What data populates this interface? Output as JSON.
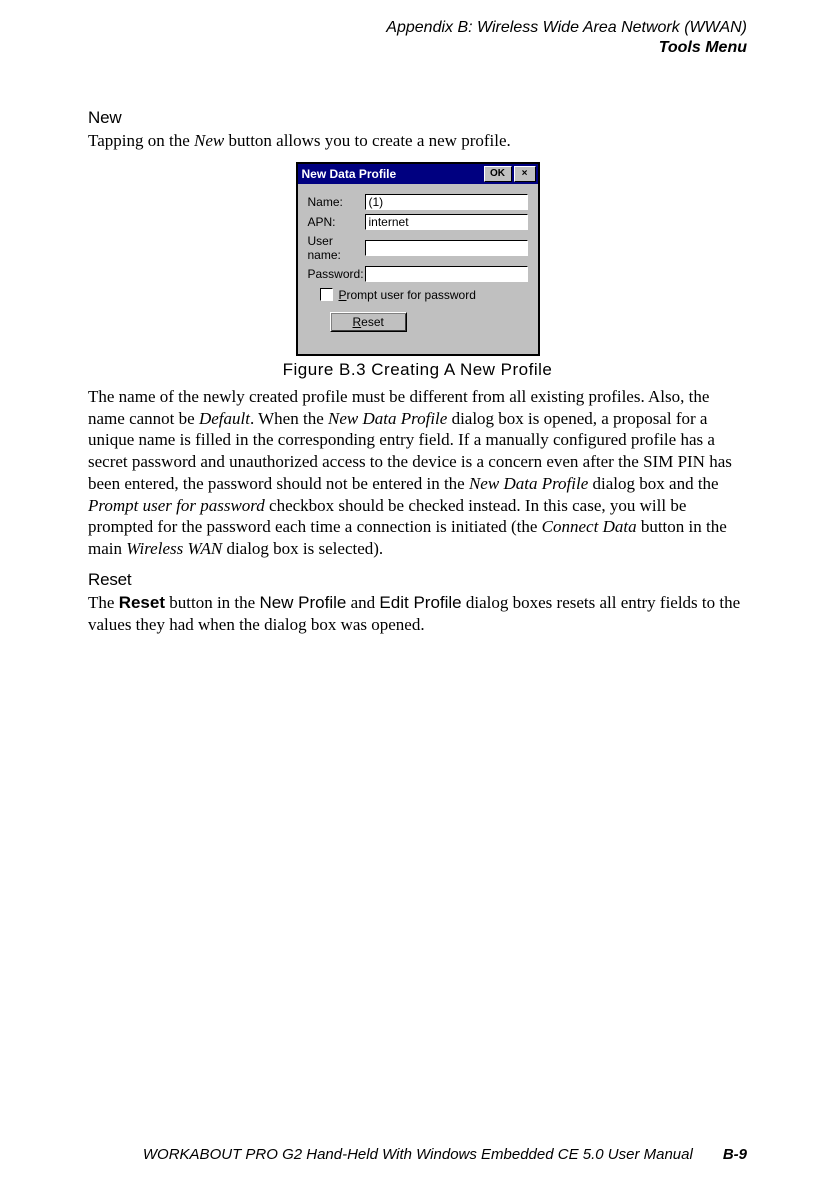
{
  "header": {
    "line1": "Appendix  B:  Wireless Wide Area Network (WWAN)",
    "line2": "Tools Menu"
  },
  "section_new": {
    "heading": "New",
    "para_pre": "Tapping on the ",
    "para_ital": "New",
    "para_post": " button allows you to create a new profile."
  },
  "dialog": {
    "title": "New Data Profile",
    "ok": "OK",
    "close": "×",
    "fields": {
      "name_label": "Name:",
      "name_value": "(1)",
      "apn_label": "APN:",
      "apn_value": "internet",
      "user_label": "User name:",
      "user_value": "",
      "pass_label": "Password:",
      "pass_value": ""
    },
    "checkbox_pre": "P",
    "checkbox_rest": "rompt user for password",
    "reset_pre": "R",
    "reset_rest": "eset"
  },
  "figure_caption": "Figure B.3  Creating A New Profile",
  "para2": {
    "t1": "The name of the newly created profile must be different from all existing profiles. Also, the name cannot be ",
    "i1": "Default",
    "t2": ". When the ",
    "i2": "New Data Profile",
    "t3": " dialog box is opened, a proposal for a unique name is filled in the corresponding entry field. If a manually configured profile has a secret password and unauthorized access to the device is a concern even after the SIM PIN has been entered, the password should not be entered in the ",
    "i3": "New Data Profile",
    "t4": " dialog box and the ",
    "i4": "Prompt user for password",
    "t5": " checkbox should be checked instead. In this case, you will be prompted for the password each time a connection is initiated (the ",
    "i5": "Connect Data",
    "t6": " button in the main  ",
    "i6": "Wireless WAN",
    "t7": "  dialog box is selected)."
  },
  "section_reset": {
    "heading": "Reset",
    "t1": "The ",
    "b1": "Reset",
    "t2": " button in the ",
    "b2": "New Profile",
    "t3": " and ",
    "b3": "Edit Profile",
    "t4": " dialog boxes resets all entry fields to the values they had when the dialog box was opened."
  },
  "footer": {
    "title": "WORKABOUT PRO G2 Hand-Held With Windows Embedded CE 5.0 User Manual",
    "page": "B-9"
  }
}
